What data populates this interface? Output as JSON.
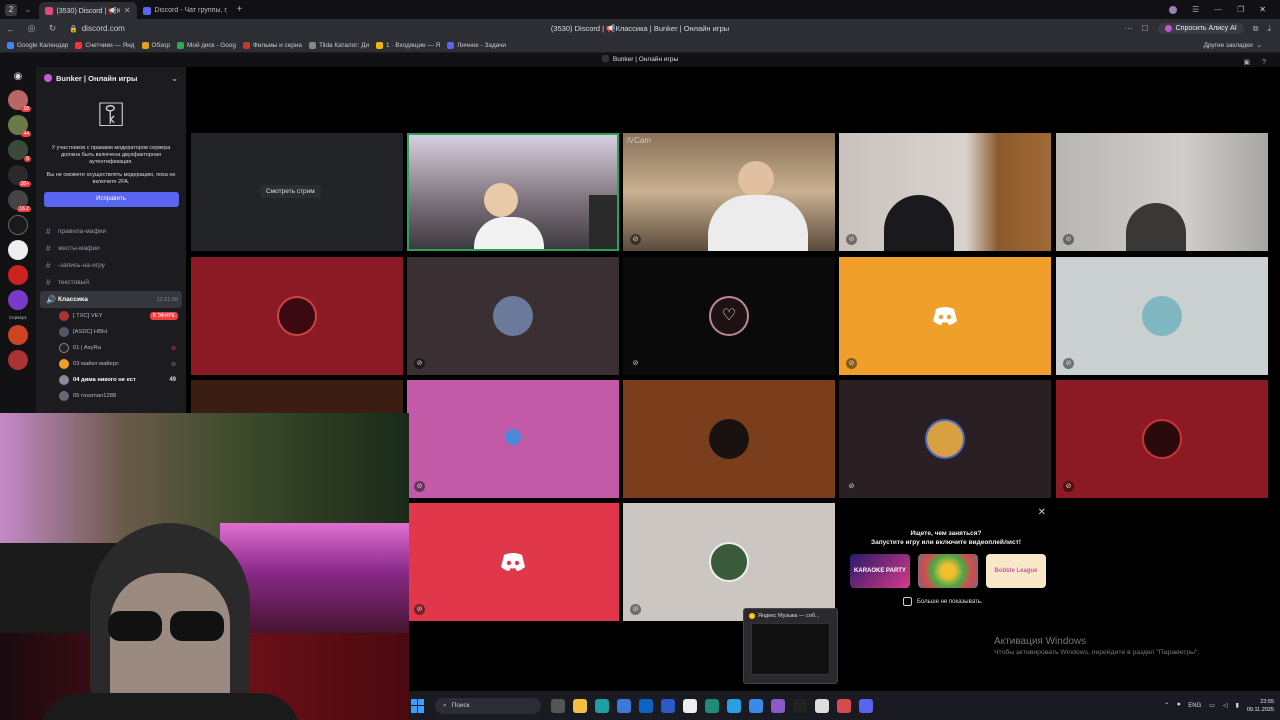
{
  "browser": {
    "tabs": [
      {
        "title": "(3530) Discord | 📢Кла",
        "active": true
      },
      {
        "title": "Discord - Чат группы, гдe",
        "active": false
      }
    ],
    "url": "discord.com",
    "page_title": "(3530) Discord | 📢Классика | Bunker | Онлайн игры",
    "alice_label": "Спросить Алису AI",
    "bookmarks": [
      "Google Календар",
      "Счетчики — Янд",
      "Обзор",
      "Мой диск - Goog",
      "Фильмы и сериа",
      "Tilda Каталог: Ди",
      "1 · Входящие — Я",
      "Личное - Задачи"
    ],
    "other_bookmarks": "Другие закладки"
  },
  "discord": {
    "title_strip": "Bunker | Онлайн игры",
    "server_name": "Bunker | Онлайн игры",
    "rail": {
      "badges": [
        "18",
        "44",
        "8",
        "38+",
        "16.2"
      ],
      "label": "Сервер1"
    },
    "mfa": {
      "text1": "У участников с правами модераторов сервера должна быть включена двухфакторная аутентификация.",
      "text2": "Вы не сможете осуществлять модерацию, пока не включите 2FA.",
      "button": "Исправить"
    },
    "channels": [
      "правила-мафии",
      "жесты-мафии",
      "-запись-на-игру",
      "текстовый"
    ],
    "voice_channel": {
      "name": "Классика",
      "time": "12:21:09"
    },
    "voice_users": [
      {
        "name": "[ TXC] VEY",
        "badge": "В ЭФИРЕ"
      },
      {
        "name": "[ASDC] НВЫ"
      },
      {
        "name": "01 | AsyRa"
      },
      {
        "name": "03 майкл майерс"
      },
      {
        "name": "04 дима никого не ест",
        "extra": "49"
      },
      {
        "name": "05 rossman1288"
      }
    ],
    "stream_button": "Смотреть стрим",
    "cam_label": "iVCam",
    "activity": {
      "title_line1": "Ищете, чем заняться?",
      "title_line2": "Запустите игру или включите видеоплейлист!",
      "cards": [
        "KARAOKE PARTY",
        "",
        "Bobble League"
      ],
      "dont_show": "Больше не показывать."
    }
  },
  "music_popup": {
    "title": "Яндекс Музыка — соб..."
  },
  "watermark": {
    "line1": "Активация Windows",
    "line2": "Чтобы активировать Windows, перейдите в раздел \"Параметры\"."
  },
  "taskbar": {
    "search_placeholder": "Поиск",
    "lang": "ENG",
    "time": "23:55",
    "date": "09.11.2025"
  },
  "colors": {
    "tile_red": "#8b1a24",
    "tile_orange": "#f0a02a",
    "tile_pink": "#c25aa8",
    "tile_brown": "#7a3e1c",
    "tile_crimson": "#e0384a",
    "accent": "#5865f2"
  }
}
